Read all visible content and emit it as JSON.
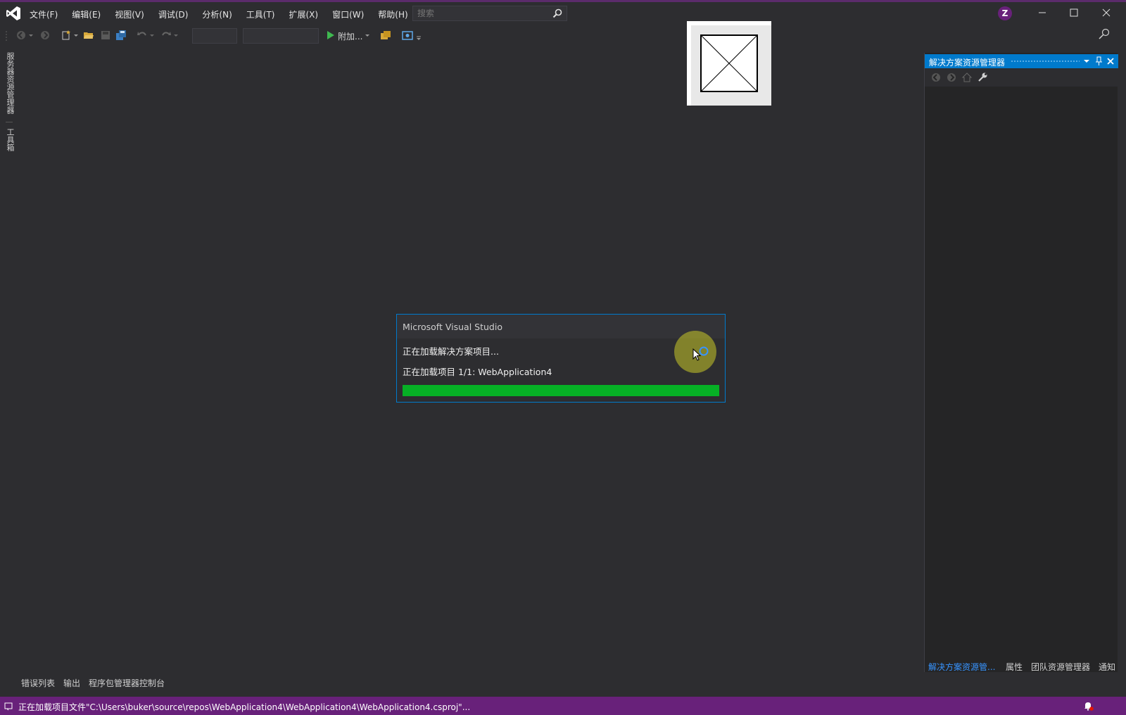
{
  "menu": {
    "items": [
      "文件(F)",
      "编辑(E)",
      "视图(V)",
      "调试(D)",
      "分析(N)",
      "工具(T)",
      "扩展(X)",
      "窗口(W)",
      "帮助(H)"
    ],
    "search_placeholder": "搜索"
  },
  "user": {
    "initial": "Z"
  },
  "toolbar": {
    "attach_label": "附加..."
  },
  "left_tabs": {
    "server_explorer": "服务器资源管理器",
    "toolbox": "工具箱"
  },
  "solution_explorer": {
    "title": "解决方案资源管理器",
    "bottom_tabs": [
      "解决方案资源管...",
      "属性",
      "团队资源管理器",
      "通知"
    ]
  },
  "bottom_panel": {
    "tabs": [
      "错误列表",
      "输出",
      "程序包管理器控制台"
    ]
  },
  "dialog": {
    "title": "Microsoft Visual Studio",
    "line1": "正在加载解决方案项目...",
    "line2": "正在加载项目 1/1: WebApplication4",
    "progress": 1.0
  },
  "status": {
    "text": "正在加载项目文件\"C:\\Users\\buker\\source\\repos\\WebApplication4\\WebApplication4\\WebApplication4.csproj\"..."
  },
  "colors": {
    "accent": "#007acc",
    "statusbar": "#68217a",
    "progress": "#06b025",
    "background": "#2d2d30"
  },
  "icons": [
    "vs-logo-icon",
    "search-icon",
    "minimize-icon",
    "maximize-icon",
    "close-icon",
    "back-icon",
    "forward-icon",
    "new-project-icon",
    "open-folder-icon",
    "save-icon",
    "save-all-icon",
    "undo-icon",
    "redo-icon",
    "start-icon",
    "browse-icon",
    "feedback-icon",
    "dropdown-icon",
    "pin-icon",
    "home-icon",
    "wrench-icon",
    "spinner-icon",
    "cursor-icon",
    "notification-icon"
  ]
}
